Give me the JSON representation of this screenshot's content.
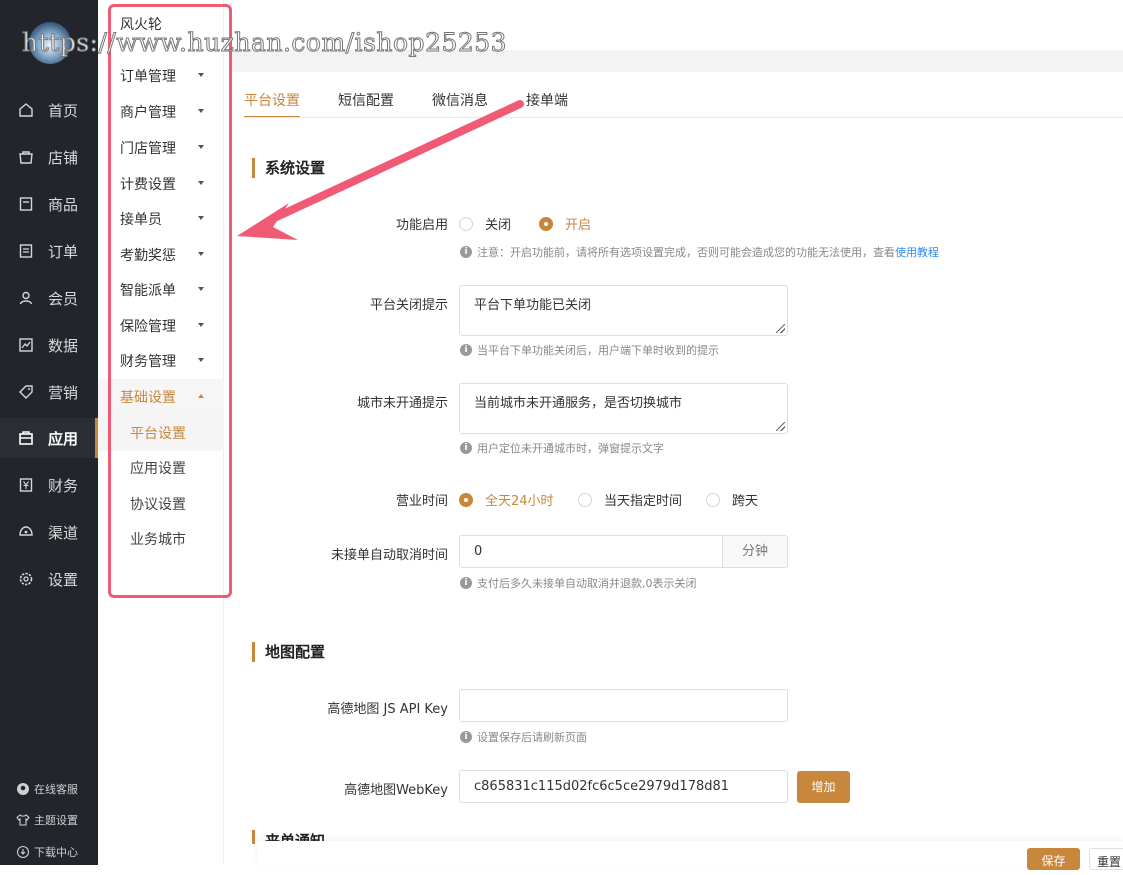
{
  "watermark": "https://www.huzhan.com/ishop25253",
  "colors": {
    "accent": "#c8873d",
    "sidebar_bg": "#22252b",
    "highlight_box": "#f05a74",
    "link": "#2d8cf0"
  },
  "sidebar": {
    "items": [
      {
        "label": "首页",
        "icon": "home-icon"
      },
      {
        "label": "店铺",
        "icon": "shop-icon"
      },
      {
        "label": "商品",
        "icon": "goods-icon"
      },
      {
        "label": "订单",
        "icon": "order-icon"
      },
      {
        "label": "会员",
        "icon": "user-icon"
      },
      {
        "label": "数据",
        "icon": "chart-icon"
      },
      {
        "label": "营销",
        "icon": "tag-icon"
      },
      {
        "label": "应用",
        "icon": "app-icon",
        "active": true
      },
      {
        "label": "财务",
        "icon": "yen-icon"
      },
      {
        "label": "渠道",
        "icon": "channel-icon"
      },
      {
        "label": "设置",
        "icon": "gear-icon"
      }
    ],
    "bottom": [
      {
        "label": "在线客服",
        "icon": "service-icon"
      },
      {
        "label": "主题设置",
        "icon": "shirt-icon"
      },
      {
        "label": "下载中心",
        "icon": "download-icon"
      }
    ]
  },
  "subnav": {
    "title": "风火轮",
    "groups": [
      "订单管理",
      "商户管理",
      "门店管理",
      "计费设置",
      "接单员",
      "考勤奖惩",
      "智能派单",
      "保险管理",
      "财务管理",
      "基础设置"
    ],
    "children": [
      "平台设置",
      "应用设置",
      "协议设置",
      "业务城市"
    ]
  },
  "tabs": [
    "平台设置",
    "短信配置",
    "微信消息",
    "接单端"
  ],
  "system": {
    "title": "系统设置",
    "enable_label": "功能启用",
    "enable_options": [
      "关闭",
      "开启"
    ],
    "enable_hint_text": "注意：开启功能前，请将所有选项设置完成，否则可能会造成您的功能无法使用，查看",
    "enable_hint_link": "使用教程",
    "close_tip_label": "平台关闭提示",
    "close_tip_value": "平台下单功能已关闭",
    "close_tip_hint": "当平台下单功能关闭后，用户端下单时收到的提示",
    "city_tip_label": "城市未开通提示",
    "city_tip_value": "当前城市未开通服务，是否切换城市",
    "city_tip_hint": "用户定位未开通城市时，弹窗提示文字",
    "hours_label": "营业时间",
    "hours_options": [
      "全天24小时",
      "当天指定时间",
      "跨天"
    ],
    "cancel_label": "未接单自动取消时间",
    "cancel_value": "0",
    "cancel_unit": "分钟",
    "cancel_hint": "支付后多久未接单自动取消并退款,0表示关闭"
  },
  "map": {
    "title": "地图配置",
    "js_key_label": "高德地图 JS API Key",
    "js_key_value": "",
    "js_key_hint": "设置保存后请刷新页面",
    "web_key_label": "高德地图WebKey",
    "web_key_value": "c865831c115d02fc6c5ce2979d178d81",
    "add_button": "增加"
  },
  "next_section_partial": "来单通知",
  "footer": {
    "save": "保存",
    "reset": "重置"
  }
}
